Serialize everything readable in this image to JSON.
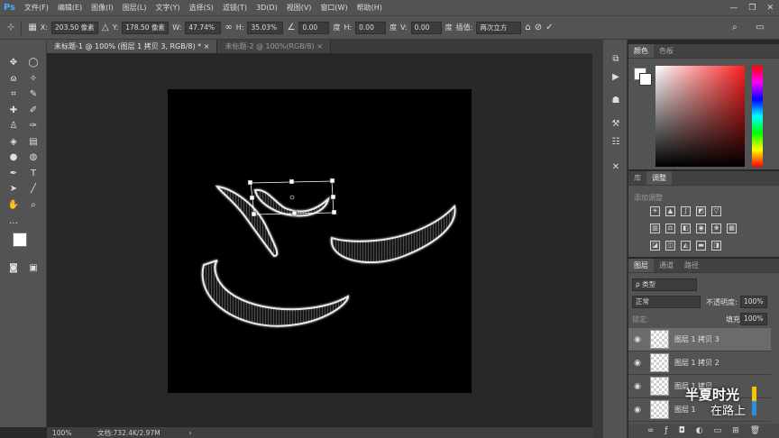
{
  "app": {
    "logo": "Ps"
  },
  "menu": [
    "文件(F)",
    "编辑(E)",
    "图像(I)",
    "图层(L)",
    "文字(Y)",
    "选择(S)",
    "滤镜(T)",
    "3D(D)",
    "视图(V)",
    "窗口(W)",
    "帮助(H)"
  ],
  "window_controls": {
    "minimize": "—",
    "restore": "❐",
    "close": "✕"
  },
  "options": {
    "x_label": "X:",
    "x_value": "203.50 像素",
    "y_label": "Y:",
    "y_value": "178.50 像素",
    "w_label": "W:",
    "w_value": "47.74%",
    "h_label": "H:",
    "h_value": "35.03%",
    "angle_value": "0.00",
    "angle_unit": "度",
    "hskew_label": "H:",
    "hskew_value": "0.00",
    "hskew_unit": "度",
    "vskew_label": "V:",
    "vskew_value": "0.00",
    "vskew_unit": "度",
    "interp_label": "插值:",
    "interp_value": "两次立方"
  },
  "tabs": [
    {
      "label": "未标题-1 @ 100% (图层 1 拷贝 3, RGB/8) *",
      "close": "×",
      "active": true
    },
    {
      "label": "未标题-2 @ 100%(RGB/8)",
      "close": "×",
      "active": false
    }
  ],
  "status": {
    "zoom": "100%",
    "doc": "文档:732.4K/2.97M"
  },
  "color_panel": {
    "tabs": [
      "颜色",
      "色板"
    ],
    "hue_color": "#ff1f1f"
  },
  "adjust_panel": {
    "tabs": [
      "库",
      "调整"
    ],
    "heading": "添加调整"
  },
  "layers_panel": {
    "tabs": [
      "图层",
      "通道",
      "路径"
    ],
    "kind_placeholder": "ρ 类型",
    "blend_mode": "正常",
    "opacity_label": "不透明度:",
    "opacity_value": "100%",
    "lock_label": "锁定:",
    "fill_label": "填充:",
    "fill_value": "100%",
    "layers": [
      {
        "name": "图层 1 拷贝 3",
        "selected": true
      },
      {
        "name": "图层 1 拷贝 2",
        "selected": false
      },
      {
        "name": "图层 1 拷贝",
        "selected": false
      },
      {
        "name": "图层 1",
        "selected": false
      }
    ]
  },
  "watermark": {
    "line1": "半夏时光",
    "line2": "在路上"
  }
}
